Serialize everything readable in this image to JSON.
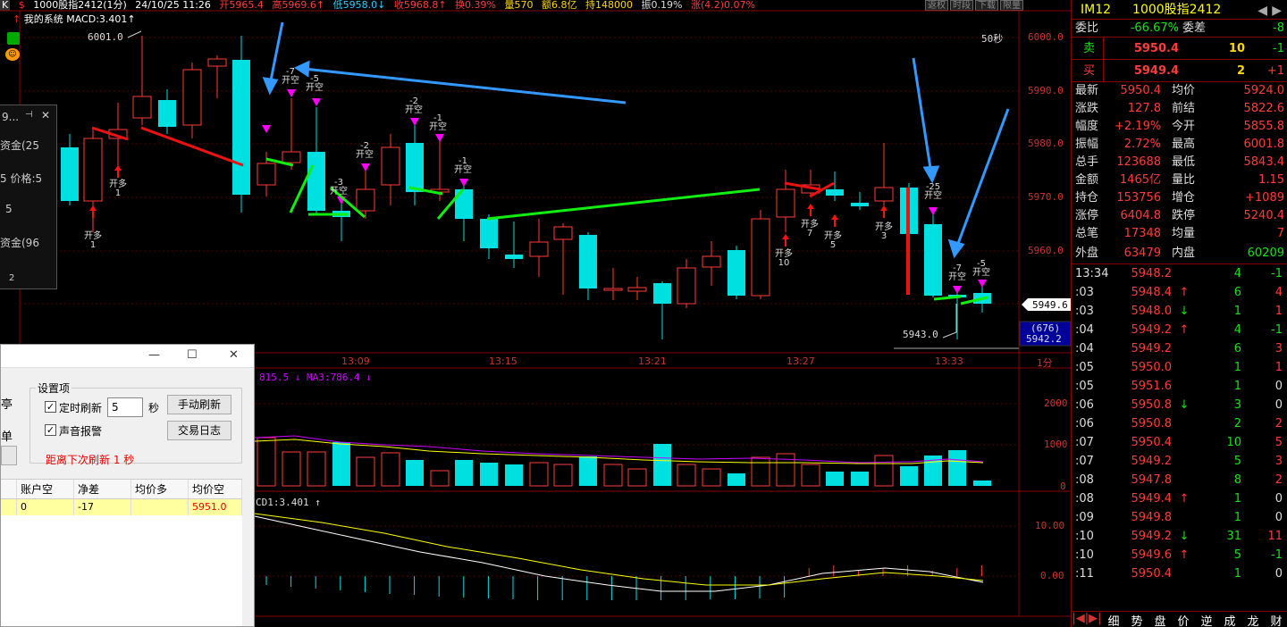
{
  "topbar": {
    "symbol_code": "$",
    "title": "1000股指2412(1分)",
    "datetime": "24/10/25 11:26",
    "open": "开5965.4",
    "high": "高5969.6",
    "high_arrow": "↑",
    "low": "低5958.0",
    "low_arrow": "↓",
    "close": "收5968.8",
    "close_arrow": "↑",
    "turnover_rate": "换0.39%",
    "volume": "量570",
    "amount": "额6.8亿",
    "hold": "持148000",
    "amplitude": "振0.19%",
    "change": "涨(4.2)0.07%",
    "buttons": [
      "返权",
      "时段",
      "下载",
      "限量"
    ]
  },
  "chart_header": {
    "system_name": "我的系统",
    "macd": "MACD:3.401",
    "macd_arrow": "↑",
    "period": "50秒",
    "high_marker": "6001.0",
    "low_marker": "5943.0",
    "current_price_tag": "5949.6",
    "order_tag": "(676)",
    "order_price": "5942.2",
    "vol_header": "815.5 ↓ MA3:786.4 ↓",
    "macd_header": "CD1:3.401 ↑",
    "period_label": "1分"
  },
  "price_axis": [
    "6000.0",
    "5990.0",
    "5980.0",
    "5970.0",
    "5960.0"
  ],
  "vol_axis": [
    "2000",
    "1000",
    "0"
  ],
  "macd_axis": [
    "10.00",
    "0.00"
  ],
  "time_axis": [
    "13:09",
    "13:15",
    "13:21",
    "13:27",
    "13:33"
  ],
  "annotations": [
    {
      "text": "开多",
      "n": "1"
    },
    {
      "text": "开多",
      "n": "1"
    },
    {
      "text": "开空",
      "n": "-7"
    },
    {
      "text": "开空",
      "n": "-5"
    },
    {
      "text": "开空",
      "n": "-3"
    },
    {
      "text": "开空",
      "n": "-2"
    },
    {
      "text": "开空",
      "n": "-2"
    },
    {
      "text": "开空",
      "n": "-1"
    },
    {
      "text": "开空",
      "n": "-1"
    },
    {
      "text": "开多",
      "n": "10"
    },
    {
      "text": "开多",
      "n": "7"
    },
    {
      "text": "开多",
      "n": "5"
    },
    {
      "text": "开多",
      "n": "3"
    },
    {
      "text": "开空",
      "n": "-25"
    },
    {
      "text": "开空",
      "n": "-7"
    },
    {
      "text": "开空",
      "n": "-5"
    }
  ],
  "popup": {
    "title": "9...",
    "items": [
      "资金(25",
      "5 价格:5",
      "5",
      "资金(96"
    ],
    "num": "2"
  },
  "dialog": {
    "section": "设置项",
    "timed_refresh": "定时刷新",
    "interval_value": "5",
    "interval_unit": "秒",
    "manual_refresh": "手动刷新",
    "sound_alert": "声音报警",
    "trade_log": "交易日志",
    "countdown": "距离下次刷新 1 秒",
    "left_labels": [
      "亭",
      "单"
    ],
    "table_headers": [
      "账户空",
      "净差",
      "均价多",
      "均价空"
    ],
    "table_row": [
      "0",
      "-17",
      "",
      "5951.0"
    ]
  },
  "quote_panel": {
    "code": "IM12",
    "name": "1000股指2412",
    "ratio_label": "委比",
    "ratio_value": "-66.67%",
    "diff_label": "委差",
    "diff_value": "-8",
    "sell_label": "卖",
    "sell_price": "5950.4",
    "sell_qty": "10",
    "sell_chg": "-1",
    "buy_label": "买",
    "buy_price": "5949.4",
    "buy_qty": "2",
    "buy_chg": "+1",
    "stats": [
      [
        "最新",
        "5950.4",
        "均价",
        "5924.0"
      ],
      [
        "涨跌",
        "127.8",
        "前结",
        "5822.6"
      ],
      [
        "幅度",
        "+2.19%",
        "今开",
        "5855.8"
      ],
      [
        "振幅",
        "2.72%",
        "最高",
        "6001.8"
      ],
      [
        "总手",
        "123688",
        "最低",
        "5843.4"
      ],
      [
        "金额",
        "1465亿",
        "量比",
        "1.15"
      ],
      [
        "持仓",
        "153756",
        "增仓",
        "+1089"
      ],
      [
        "涨停",
        "6404.8",
        "跌停",
        "5240.4"
      ],
      [
        "总笔",
        "17348",
        "均量",
        "7"
      ]
    ],
    "outer_label": "外盘",
    "outer_value": "63479",
    "inner_label": "内盘",
    "inner_value": "60209",
    "ticks": [
      [
        "13:34",
        "5948.2",
        "",
        "4",
        "-1"
      ],
      [
        ":03",
        "5948.4",
        "↑",
        "6",
        "4"
      ],
      [
        ":03",
        "5948.0",
        "↓",
        "1",
        "1"
      ],
      [
        ":04",
        "5949.2",
        "↑",
        "4",
        "-1"
      ],
      [
        ":04",
        "5949.2",
        "",
        "6",
        "3"
      ],
      [
        ":05",
        "5950.0",
        "",
        "1",
        "1"
      ],
      [
        ":05",
        "5951.6",
        "",
        "1",
        "0"
      ],
      [
        ":06",
        "5950.8",
        "↓",
        "3",
        "0"
      ],
      [
        ":06",
        "5950.8",
        "",
        "2",
        "2"
      ],
      [
        ":07",
        "5950.4",
        "",
        "10",
        "5"
      ],
      [
        ":07",
        "5949.2",
        "",
        "5",
        "3"
      ],
      [
        ":08",
        "5947.8",
        "",
        "8",
        "2"
      ],
      [
        ":08",
        "5949.4",
        "↑",
        "1",
        "0"
      ],
      [
        ":09",
        "5949.8",
        "",
        "1",
        "0"
      ],
      [
        ":10",
        "5949.2",
        "↓",
        "31",
        "11"
      ],
      [
        ":10",
        "5949.6",
        "↑",
        "5",
        "-1"
      ],
      [
        ":11",
        "5950.4",
        "",
        "1",
        "0"
      ]
    ],
    "tabs": [
      "细",
      "势",
      "盘",
      "价",
      "逆",
      "成",
      "龙",
      "财"
    ]
  }
}
